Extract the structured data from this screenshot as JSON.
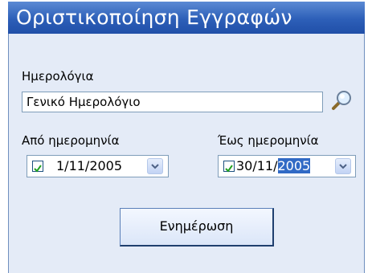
{
  "header": {
    "title": "Οριστικοποίηση Εγγραφών"
  },
  "journal": {
    "label": "Ημερολόγια",
    "value": "Γενικό Ημερολόγιο",
    "search_icon": "magnifier-icon"
  },
  "from_date": {
    "label": "Από ημερομηνία",
    "checked": true,
    "value": "1/11/2005"
  },
  "to_date": {
    "label": "Έως ημερομηνία",
    "checked": true,
    "value_prefix": "30/11/",
    "value_selected": "2005"
  },
  "actions": {
    "update_label": "Ενημέρωση"
  },
  "colors": {
    "header": "#2d5fb8",
    "panel": "#e4ebf7",
    "selection": "#316ac5"
  }
}
